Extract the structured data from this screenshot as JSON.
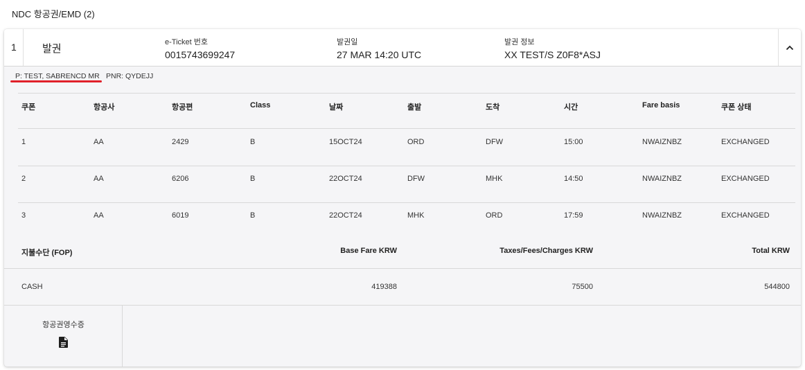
{
  "section": {
    "title": "NDC 항공권/EMD (2)"
  },
  "ticket": {
    "index": "1",
    "status": "발권",
    "eticket_label": "e-Ticket 번호",
    "eticket_value": "0015743699247",
    "issue_date_label": "발권일",
    "issue_date_value": "27 MAR 14:20 UTC",
    "issue_info_label": "발권 정보",
    "issue_info_value": "XX TEST/S Z0F8*ASJ",
    "toggle_icon": "chevron-up-icon"
  },
  "passenger": {
    "name": "P: TEST, SABRENCD MR",
    "pnr": "PNR: QYDEJJ"
  },
  "coupon_table": {
    "headers": [
      "쿠폰",
      "항공사",
      "항공편",
      "Class",
      "날짜",
      "출발",
      "도착",
      "시간",
      "Fare basis",
      "쿠폰 상태"
    ],
    "rows": [
      [
        "1",
        "AA",
        "2429",
        "B",
        "15OCT24",
        "ORD",
        "DFW",
        "15:00",
        "NWAIZNBZ",
        "EXCHANGED"
      ],
      [
        "2",
        "AA",
        "6206",
        "B",
        "22OCT24",
        "DFW",
        "MHK",
        "14:50",
        "NWAIZNBZ",
        "EXCHANGED"
      ],
      [
        "3",
        "AA",
        "6019",
        "B",
        "22OCT24",
        "MHK",
        "ORD",
        "17:59",
        "NWAIZNBZ",
        "EXCHANGED"
      ]
    ]
  },
  "fare": {
    "fop_label": "지불수단 (FOP)",
    "base_label": "Base Fare KRW",
    "taxes_label": "Taxes/Fees/Charges KRW",
    "total_label": "Total KRW",
    "fop_value": "CASH",
    "base_value": "419388",
    "taxes_value": "75500",
    "total_value": "544800"
  },
  "receipt": {
    "label": "항공권영수증",
    "icon": "document-icon"
  }
}
